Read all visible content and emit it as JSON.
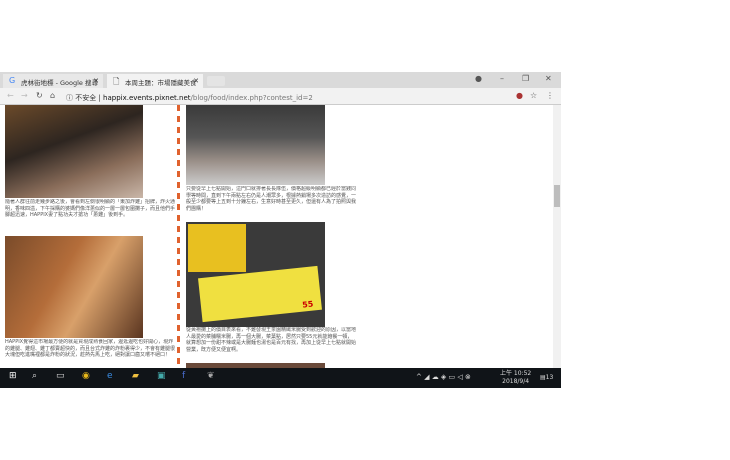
{
  "browser": {
    "tabs": [
      {
        "title": "虎林街地標 - Google 搜尋",
        "icon": "google-icon"
      },
      {
        "title": "本周主題：市場隱藏美食",
        "icon": "page-icon"
      }
    ],
    "address": {
      "security": "不安全",
      "host": "happix.events.pixnet.net",
      "path": "/blog/food/index.php?contest_id=2"
    }
  },
  "article": {
    "left": [
      {
        "text": "隨著人群往前走幾步路之後，會看到左側很明顯的「東加炸雞」招牌，炸火通明，香味四溢，下午採購的婆媽們像洋蔥似的一層一層包圍攤子，而且他們手腳超迅速，HAPPIX妻了點功夫才搶功「蔥雞」後到手。"
      },
      {
        "text": "HAPPIX覺得這市場最方便的就是買現成熟食回家，邊逛邊吃也好開心，現炸的雞腿、雞翅、雞丁都賣超快的，而且台式炸雞的炸粉裹得少，不會有雞腿很大塊但吃進嘴裡都是炸粉的狀況，趁熱先馬上吃，絕對讓口齒又嚐不絕口！"
      }
    ],
    "right": [
      {
        "text": "只要從早上七點開始，這門口就排著長長隊伍，價格超級明顯都已經於當錢同學等時間，直到下午兩點左右仍是人潮眾多，根據熱銷場多次造訪的感覺，一般至少都要等上五到十分鐘左右，生意好時甚至更久，但還有人為了拍照與我們團購！"
      },
      {
        "text": "從黃袍攤上的價目表來看，不難發現王茶園精緻米腸受到歡迎的原因，以當地人最愛的菜脯糯米腸，再一個大腸，菜葉點，居然只要55元就能飽餐一頓，就算想加一份甜不辣或是大腸麵也湯也是百元有找，再加上從早上七點就開始營業，既方便又便宜啊。"
      }
    ],
    "sign_price": "55"
  },
  "taskbar": {
    "time": "上午 10:52",
    "date": "2018/9/4",
    "notifications": "13"
  }
}
